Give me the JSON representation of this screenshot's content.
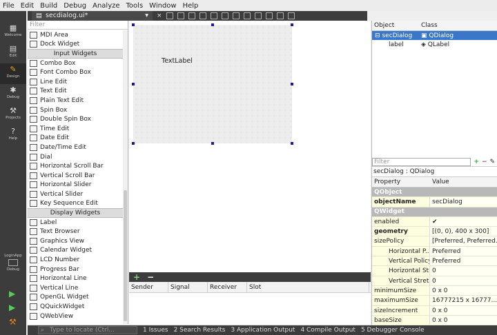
{
  "menu": [
    "File",
    "Edit",
    "Build",
    "Debug",
    "Analyze",
    "Tools",
    "Window",
    "Help"
  ],
  "modes": [
    {
      "label": "Welcome",
      "icon": "grid-icon"
    },
    {
      "label": "Edit",
      "icon": "document-icon"
    },
    {
      "label": "Design",
      "icon": "pencil-icon"
    },
    {
      "label": "Debug",
      "icon": "bug-icon"
    },
    {
      "label": "Projects",
      "icon": "wrench-icon"
    },
    {
      "label": "Help",
      "icon": "help-icon"
    }
  ],
  "kit": {
    "app": "LoginApp",
    "mode": "Debug"
  },
  "editor": {
    "document": "secdialog.ui*"
  },
  "widgetbox": {
    "filter_placeholder": "Filter",
    "items": [
      {
        "label": "MDI Area"
      },
      {
        "label": "Dock Widget"
      },
      {
        "category": "Input Widgets"
      },
      {
        "label": "Combo Box"
      },
      {
        "label": "Font Combo Box"
      },
      {
        "label": "Line Edit"
      },
      {
        "label": "Text Edit"
      },
      {
        "label": "Plain Text Edit"
      },
      {
        "label": "Spin Box"
      },
      {
        "label": "Double Spin Box"
      },
      {
        "label": "Time Edit"
      },
      {
        "label": "Date Edit"
      },
      {
        "label": "Date/Time Edit"
      },
      {
        "label": "Dial"
      },
      {
        "label": "Horizontal Scroll Bar"
      },
      {
        "label": "Vertical Scroll Bar"
      },
      {
        "label": "Horizontal Slider"
      },
      {
        "label": "Vertical Slider"
      },
      {
        "label": "Key Sequence Edit"
      },
      {
        "category": "Display Widgets"
      },
      {
        "label": "Label"
      },
      {
        "label": "Text Browser"
      },
      {
        "label": "Graphics View"
      },
      {
        "label": "Calendar Widget"
      },
      {
        "label": "LCD Number"
      },
      {
        "label": "Progress Bar"
      },
      {
        "label": "Horizontal Line"
      },
      {
        "label": "Vertical Line"
      },
      {
        "label": "OpenGL Widget"
      },
      {
        "label": "QQuickWidget"
      },
      {
        "label": "QWebView"
      }
    ]
  },
  "form": {
    "label": "TextLabel"
  },
  "signals": {
    "columns": [
      "Sender",
      "Signal",
      "Receiver",
      "Slot"
    ]
  },
  "objects": {
    "columns": [
      "Object",
      "Class"
    ],
    "rows": [
      {
        "name": "secDialog",
        "cls": "QDialog"
      },
      {
        "name": "label",
        "cls": "QLabel"
      }
    ]
  },
  "properties": {
    "filter_placeholder": "Filter",
    "title": "secDialog : QDialog",
    "columns": [
      "Property",
      "Value"
    ],
    "rows": [
      {
        "cat": "QObject"
      },
      {
        "name": "objectName",
        "value": "secDialog"
      },
      {
        "cat": "QWidget"
      },
      {
        "name": "enabled",
        "value": "✔"
      },
      {
        "name": "geometry",
        "value": "[(0, 0), 400 x 300]"
      },
      {
        "name": "sizePolicy",
        "value": "[Preferred, Preferred..."
      },
      {
        "name": "Horizontal P...",
        "value": "Preferred",
        "sub": true
      },
      {
        "name": "Vertical Policy",
        "value": "Preferred",
        "sub": true
      },
      {
        "name": "Horizontal St...",
        "value": "0",
        "sub": true
      },
      {
        "name": "Vertical Stret...",
        "value": "0",
        "sub": true
      },
      {
        "name": "minimumSize",
        "value": "0 x 0"
      },
      {
        "name": "maximumSize",
        "value": "16777215 x 16777..."
      },
      {
        "name": "sizeIncrement",
        "value": "0 x 0"
      },
      {
        "name": "baseSize",
        "value": "0 x 0"
      }
    ]
  },
  "status": {
    "locate_placeholder": "Type to locate (Ctrl...",
    "tabs": [
      "1 Issues",
      "2 Search Results",
      "3 Application Output",
      "4 Compile Output",
      "5 Debugger Console"
    ]
  }
}
